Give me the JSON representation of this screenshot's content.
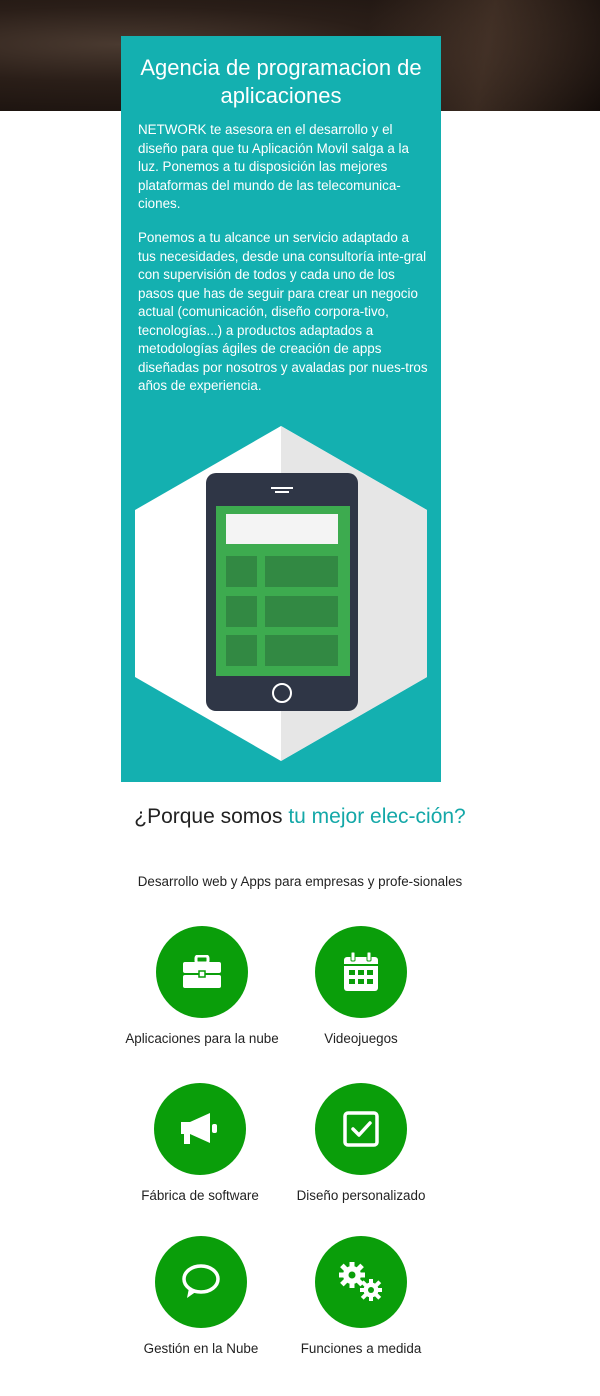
{
  "hero": {
    "title": "Agencia de programacion de aplicaciones",
    "paragraph1": "NETWORK te asesora en el desarrollo y el diseño para que tu Aplicación Movil salga a la luz. Ponemos a tu disposición las mejores plataformas del mundo de las telecomunica-ciones.",
    "paragraph2": "Ponemos a tu alcance un servicio adaptado a tus necesidades, desde una consultoría inte-gral con supervisión de todos y cada uno de los pasos que has de seguir para crear un negocio actual (comunicación, diseño corpora-tivo, tecnologías...) a productos adaptados a metodologías ágiles de creación de apps diseñadas por nosotros y avaladas por nues-tros años de experiencia."
  },
  "why": {
    "title_part1": "¿Porque somos ",
    "title_accent": "tu mejor elec-ción?",
    "subtitle": "Desarrollo web y Apps para empresas y profe-sionales"
  },
  "features": [
    {
      "label": "Aplicaciones para la nube",
      "icon": "briefcase-icon"
    },
    {
      "label": "Videojuegos",
      "icon": "calendar-icon"
    },
    {
      "label": "Fábrica de software",
      "icon": "megaphone-icon"
    },
    {
      "label": "Diseño personalizado",
      "icon": "checkbox-icon"
    },
    {
      "label": "Gestión en la Nube",
      "icon": "chat-bubble-icon"
    },
    {
      "label": "Funciones a medida",
      "icon": "gears-icon"
    }
  ],
  "colors": {
    "teal_panel": "#14b0b0",
    "accent_text": "#14a8a8",
    "icon_circle": "#0a9e0a",
    "phone_body": "#2f3646",
    "phone_screen": "#3dab4f"
  }
}
